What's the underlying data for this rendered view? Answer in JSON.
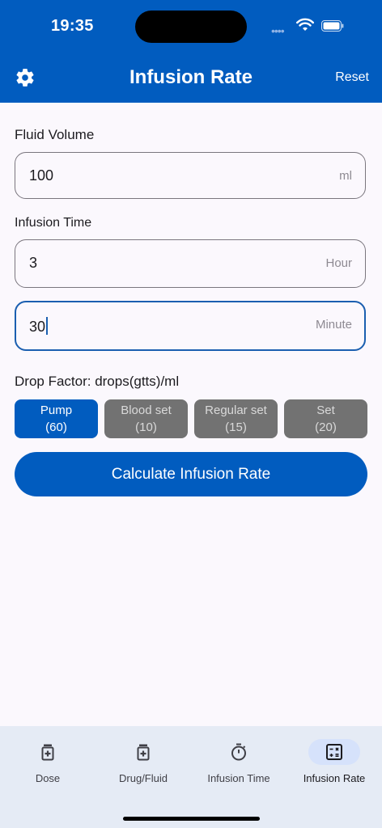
{
  "status": {
    "time": "19:35"
  },
  "header": {
    "title": "Infusion Rate",
    "reset_label": "Reset"
  },
  "fluid_volume": {
    "label": "Fluid Volume",
    "value": "100",
    "unit": "ml"
  },
  "infusion_time": {
    "label": "Infusion Time",
    "hours": {
      "value": "3",
      "unit": "Hour"
    },
    "minutes": {
      "value": "30",
      "unit": "Minute"
    }
  },
  "drop_factor": {
    "label": "Drop Factor: drops(gtts)/ml",
    "options": [
      {
        "name": "Pump",
        "value": "(60)",
        "selected": true
      },
      {
        "name": "Blood set",
        "value": "(10)",
        "selected": false
      },
      {
        "name": "Regular set",
        "value": "(15)",
        "selected": false
      },
      {
        "name": "Set",
        "value": "(20)",
        "selected": false
      }
    ]
  },
  "calculate_label": "Calculate Infusion Rate",
  "bottom_nav": {
    "items": [
      {
        "label": "Dose",
        "icon": "medicine-bottle-icon"
      },
      {
        "label": "Drug/Fluid",
        "icon": "medicine-bottle-icon"
      },
      {
        "label": "Infusion Time",
        "icon": "timer-icon"
      },
      {
        "label": "Infusion Rate",
        "icon": "calculator-icon",
        "active": true
      }
    ]
  },
  "colors": {
    "primary": "#015cbf",
    "chip_inactive": "#727272",
    "nav_bg": "#e5ebf5",
    "nav_active_pill": "#d6e2fb"
  }
}
